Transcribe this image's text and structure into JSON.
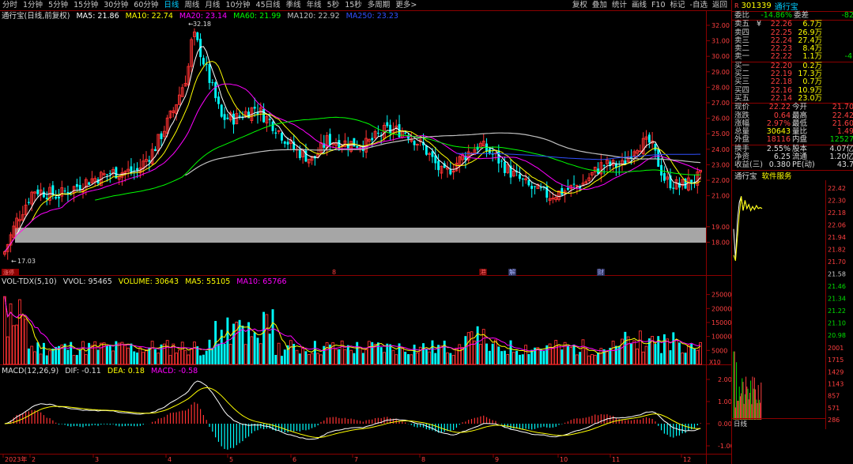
{
  "toolbar": {
    "periods": [
      "分时",
      "1分钟",
      "5分钟",
      "15分钟",
      "30分钟",
      "60分钟",
      "日线",
      "周线",
      "月线",
      "10分钟",
      "45日线",
      "季线",
      "年线",
      "5秒",
      "15秒",
      "多周期",
      "更多>"
    ],
    "active_period": "日线",
    "tools": [
      "复权",
      "叠加",
      "统计",
      "画线",
      "F10",
      "标记",
      "-自选",
      "返回"
    ]
  },
  "main_info": {
    "title": "通行宝(日线,前复权)",
    "ma5": "MA5: 21.86",
    "ma10": "MA10: 22.74",
    "ma20": "MA20: 23.14",
    "ma60": "MA60: 21.99",
    "ma120": "MA120: 22.92",
    "ma250": "MA250: 23.23"
  },
  "price_axis": [
    "32.00",
    "31.00",
    "30.00",
    "29.00",
    "28.00",
    "27.00",
    "26.00",
    "25.00",
    "24.00",
    "23.00",
    "22.00",
    "21.00",
    "19.00",
    "18.00"
  ],
  "annotations": {
    "high": "32.18",
    "low": "17.03",
    "range": "18.11 - 19.13",
    "tag1": "涨停",
    "m1": "8",
    "m2": "港",
    "m3": "解",
    "m4": "财"
  },
  "vol_info": {
    "title": "VOL-TDX(5,10)",
    "vvol": "VVOL: 95465",
    "volume": "VOLUME: 30643",
    "ma5": "MA5: 55105",
    "ma10": "MA10: 65766"
  },
  "vol_axis": [
    "25000",
    "20000",
    "15000",
    "10000",
    "5000",
    "X10"
  ],
  "macd_info": {
    "title": "MACD(12,26,9)",
    "dif": "DIF: -0.11",
    "dea": "DEA: 0.18",
    "macd": "MACD: -0.58"
  },
  "macd_axis": [
    "2.00",
    "1.00",
    "0.00",
    "-1.00"
  ],
  "date_axis": [
    "2023年",
    "2",
    "3",
    "4",
    "5",
    "6",
    "7",
    "8",
    "9",
    "10",
    "11",
    "12"
  ],
  "quote": {
    "code": "301339",
    "name": "通行宝",
    "wb_label": "委比",
    "wb_val": "-14.86%",
    "wc_label": "委差",
    "wc_val": "-82",
    "asks": [
      {
        "label": "卖五",
        "price": "22.26",
        "vol": "6.7万"
      },
      {
        "label": "卖四",
        "price": "22.25",
        "vol": "26.9万"
      },
      {
        "label": "卖三",
        "price": "22.24",
        "vol": "27.4万"
      },
      {
        "label": "卖二",
        "price": "22.23",
        "vol": "8.4万"
      },
      {
        "label": "卖一",
        "price": "22.22",
        "vol": "1.1万"
      }
    ],
    "ask_mark": "¥",
    "ask1_extra": "-4",
    "bids": [
      {
        "label": "买一",
        "price": "22.20",
        "vol": "0.2万"
      },
      {
        "label": "买二",
        "price": "22.19",
        "vol": "17.3万"
      },
      {
        "label": "买三",
        "price": "22.18",
        "vol": "0.7万"
      },
      {
        "label": "买四",
        "price": "22.16",
        "vol": "10.9万"
      },
      {
        "label": "买五",
        "price": "22.14",
        "vol": "23.0万"
      }
    ],
    "stats": [
      {
        "l1": "现价",
        "v1": "22.22",
        "l2": "今开",
        "v2": "21.70"
      },
      {
        "l1": "涨跌",
        "v1": "0.64",
        "l2": "最高",
        "v2": "22.42"
      },
      {
        "l1": "涨幅",
        "v1": "2.97%",
        "l2": "最低",
        "v2": "21.60"
      },
      {
        "l1": "总量",
        "v1": "30643",
        "l2": "量比",
        "v2": "1.49"
      },
      {
        "l1": "外盘",
        "v1": "18116",
        "l2": "内盘",
        "v2": "12527"
      }
    ],
    "stats2": [
      {
        "l1": "换手",
        "v1": "2.55%",
        "l2": "股本",
        "v2": "4.07亿"
      },
      {
        "l1": "净资",
        "v1": "6.25",
        "l2": "流通",
        "v2": "1.20亿"
      },
      {
        "l1": "收益(三)",
        "v1": "0.380",
        "l2": "PE(动)",
        "v2": "43.7"
      }
    ],
    "mini_title": "通行宝",
    "mini_tab": "软件服务",
    "mini_price_axis": [
      "22.42",
      "22.30",
      "22.18",
      "22.06",
      "21.94",
      "21.82",
      "21.70",
      "21.58",
      "21.46",
      "21.34",
      "21.22",
      "21.10",
      "20.98"
    ],
    "mini_vol_axis": [
      "2001",
      "1715",
      "1429",
      "1143",
      "857",
      "571",
      "286"
    ],
    "mini_footer": "日线"
  },
  "colors": {
    "up": "#ff3232",
    "down": "#00ffff",
    "ma5": "#ffffff",
    "ma10": "#ffff00",
    "ma20": "#ff00ff",
    "ma60": "#00ff00",
    "ma120": "#c0c0c0",
    "ma250": "#3050ff"
  }
}
